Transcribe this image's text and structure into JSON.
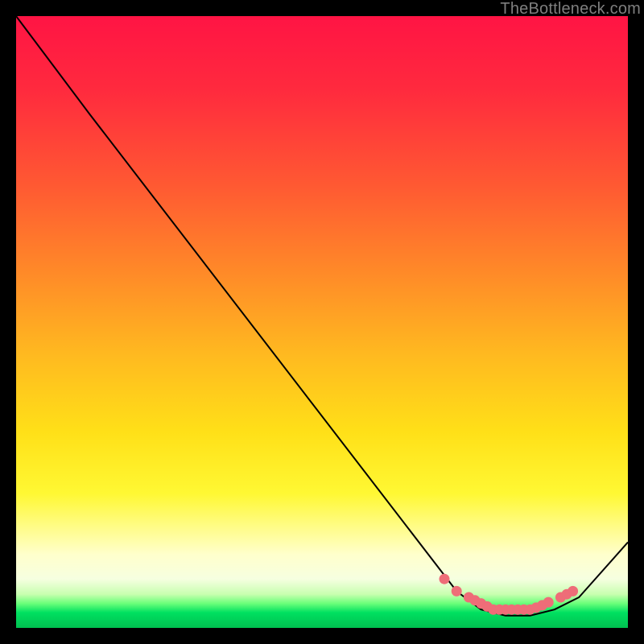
{
  "watermark": "TheBottleneck.com",
  "colors": {
    "curve_stroke": "#000000",
    "marker_fill": "#ee6d78",
    "marker_stroke": "#ee6d78"
  },
  "chart_data": {
    "type": "line",
    "title": "",
    "xlabel": "",
    "ylabel": "",
    "xlim": [
      0,
      100
    ],
    "ylim": [
      0,
      100
    ],
    "grid": false,
    "legend": false,
    "series": [
      {
        "name": "bottleneck-curve",
        "x": [
          0,
          12,
          72,
          76,
          80,
          84,
          88,
          92,
          100
        ],
        "y": [
          100,
          84,
          6,
          3,
          2,
          2,
          3,
          5,
          14
        ]
      }
    ],
    "markers": {
      "name": "optimal-range-dots",
      "x": [
        70,
        72,
        74,
        75,
        76,
        77,
        78,
        79,
        80,
        81,
        82,
        83,
        84,
        85,
        86,
        87,
        89,
        90,
        91
      ],
      "y": [
        8,
        6,
        5,
        4.5,
        4,
        3.5,
        3,
        3,
        3,
        3,
        3,
        3,
        3,
        3.3,
        3.7,
        4.2,
        5,
        5.5,
        6
      ]
    }
  }
}
